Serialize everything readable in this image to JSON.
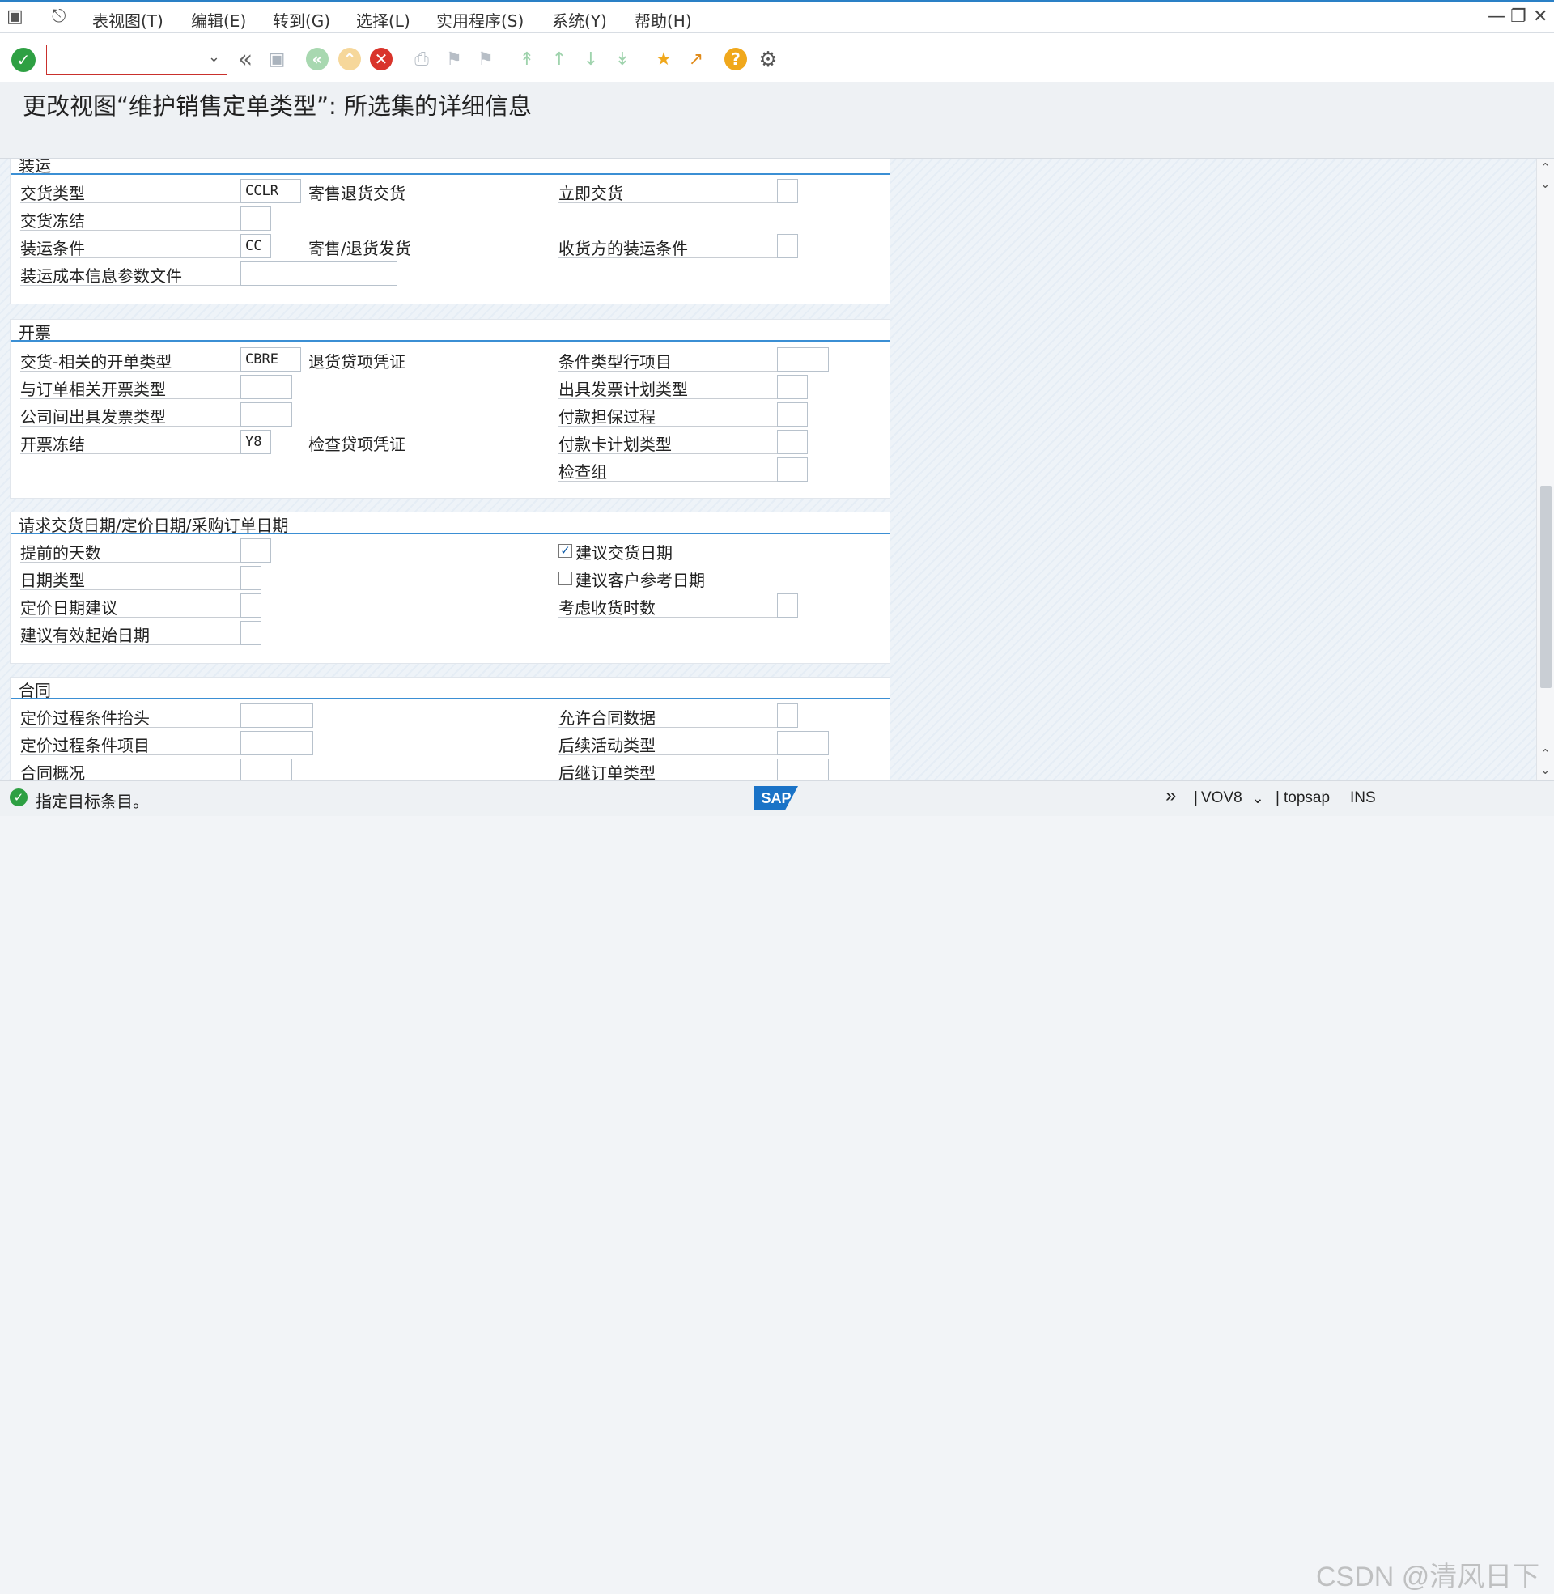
{
  "menubar": {
    "items": [
      "表视图(T)",
      "编辑(E)",
      "转到(G)",
      "选择(L)",
      "实用程序(S)",
      "系统(Y)",
      "帮助(H)"
    ]
  },
  "toolbar": {
    "command_value": "",
    "icons": [
      "check-icon",
      "double-left-icon",
      "save-icon",
      "back-icon",
      "exit-icon",
      "cancel-icon",
      "print-icon",
      "find-icon",
      "find-next-icon",
      "first-page-icon",
      "previous-page-icon",
      "next-page-icon",
      "last-page-icon",
      "create-session-icon",
      "shortcut-icon",
      "help-icon",
      "settings-icon"
    ]
  },
  "title": "更改视图“维护销售定单类型”: 所选集的详细信息",
  "sections": {
    "shipping": {
      "title": "装运",
      "delivery_type": {
        "label": "交货类型",
        "value": "CCLR"
      },
      "consignment_return_delivery": {
        "label": "寄售退货交货"
      },
      "immediate_delivery": {
        "label": "立即交货",
        "value": ""
      },
      "delivery_block": {
        "label": "交货冻结",
        "value": ""
      },
      "shipping_conditions": {
        "label": "装运条件",
        "value": "CC"
      },
      "consignment_return_issue": {
        "label": "寄售/退货发货"
      },
      "ship_to_shipping_conditions": {
        "label": "收货方的装运条件",
        "value": ""
      },
      "shipping_cost_profile": {
        "label": "装运成本信息参数文件",
        "value": ""
      }
    },
    "billing": {
      "title": "开票",
      "delivery_billing_type": {
        "label": "交货-相关的开单类型",
        "value": "CBRE"
      },
      "return_credit_memo": {
        "label": "退货贷项凭证"
      },
      "condition_type_line_item": {
        "label": "条件类型行项目",
        "value": ""
      },
      "order_billing_type": {
        "label": "与订单相关开票类型",
        "value": ""
      },
      "billing_plan_type": {
        "label": "出具发票计划类型",
        "value": ""
      },
      "intercompany_billing_type": {
        "label": "公司间出具发票类型",
        "value": ""
      },
      "payment_guarantee": {
        "label": "付款担保过程",
        "value": ""
      },
      "billing_block": {
        "label": "开票冻结",
        "value": "Y8"
      },
      "check_credit_memo": {
        "label": "检查贷项凭证"
      },
      "card_plan_type": {
        "label": "付款卡计划类型",
        "value": ""
      },
      "check_group": {
        "label": "检查组",
        "value": ""
      }
    },
    "dates": {
      "title": "请求交货日期/定价日期/采购订单日期",
      "lead_time_days": {
        "label": "提前的天数",
        "value": ""
      },
      "propose_delivery_date": {
        "label": "建议交货日期",
        "checked": true
      },
      "date_type": {
        "label": "日期类型",
        "value": ""
      },
      "propose_customer_ref_date": {
        "label": "建议客户参考日期",
        "checked": false
      },
      "pricing_date_proposal": {
        "label": "定价日期建议",
        "value": ""
      },
      "consider_receiving_times": {
        "label": "考虑收货时数",
        "value": ""
      },
      "propose_valid_from": {
        "label": "建议有效起始日期",
        "value": ""
      }
    },
    "contract": {
      "title": "合同",
      "pricing_proc_header": {
        "label": "定价过程条件抬头",
        "value": ""
      },
      "contract_data_allowed": {
        "label": "允许合同数据",
        "value": ""
      },
      "pricing_proc_item": {
        "label": "定价过程条件项目",
        "value": ""
      },
      "follow_up_activity_type": {
        "label": "后续活动类型",
        "value": ""
      },
      "contract_profile": {
        "label": "合同概况",
        "value": ""
      },
      "subsequent_order_type": {
        "label": "后继订单类型",
        "value": ""
      }
    }
  },
  "statusbar": {
    "message": "指定目标条目。",
    "transaction": "VOV8",
    "system": "topsap",
    "mode": "INS"
  },
  "watermark": "CSDN @清风日下",
  "colors": {
    "accent": "#3b8fd4",
    "menubar_top": "#2a80c6",
    "ok_green": "#2ea043",
    "cancel_red": "#d9342b",
    "help_orange": "#f0a81c"
  }
}
